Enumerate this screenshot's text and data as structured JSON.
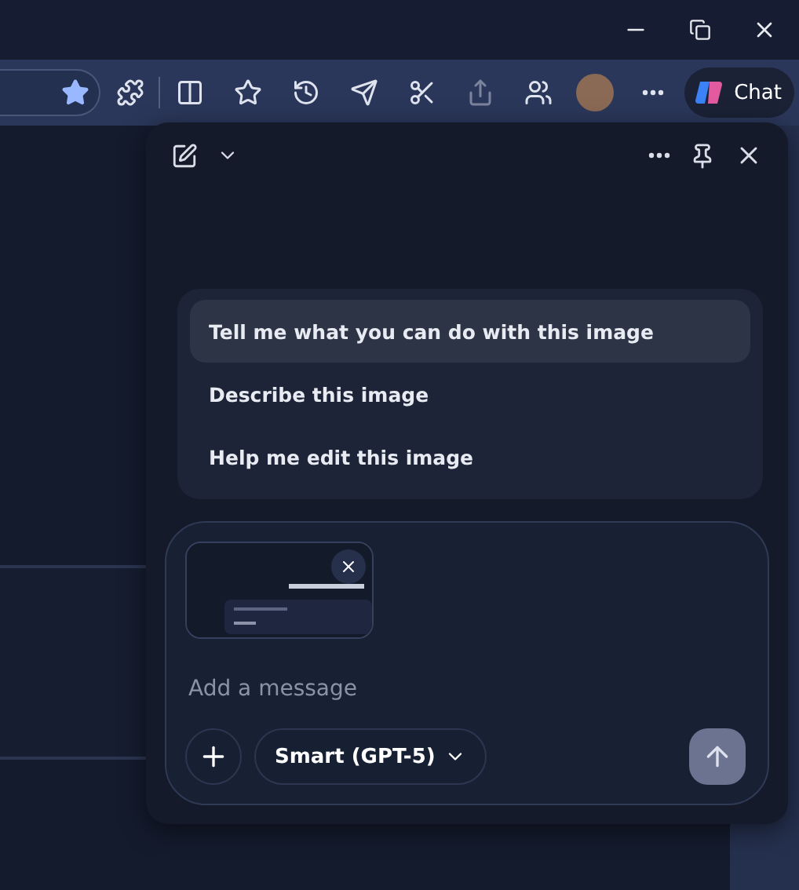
{
  "toolbar": {
    "favorite_starred": true,
    "chat_button": "Chat"
  },
  "suggestions": [
    {
      "label": "Tell me what you can do with this image",
      "selected": true
    },
    {
      "label": "Describe this image",
      "selected": false
    },
    {
      "label": "Help me edit this image",
      "selected": false
    }
  ],
  "composer": {
    "placeholder": "Add a message",
    "model": "Smart (GPT-5)"
  }
}
